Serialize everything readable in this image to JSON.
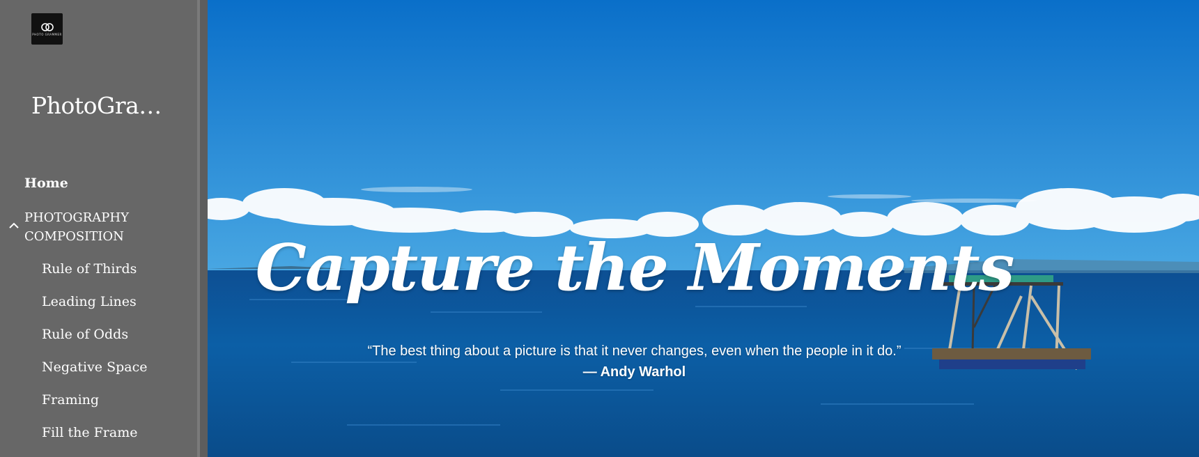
{
  "sidebar": {
    "logo_text": "PHOTO GRAMMER",
    "site_title": "PhotoGram...",
    "nav": {
      "home": "Home",
      "section": "PHOTOGRAPHY COMPOSITION",
      "items": [
        {
          "label": "Rule of Thirds"
        },
        {
          "label": "Leading Lines"
        },
        {
          "label": "Rule of Odds"
        },
        {
          "label": "Negative Space"
        },
        {
          "label": "Framing"
        },
        {
          "label": "Fill the Frame"
        }
      ]
    }
  },
  "hero": {
    "headline": "Capture the Moments",
    "quote": "“The best thing about a picture is that it never changes, even when the people in it do.”",
    "author": "— Andy Warhol",
    "colors": {
      "sky_top": "#0a6fc9",
      "sky_bottom": "#3ea0e0",
      "sea": "#0b4f93"
    }
  }
}
